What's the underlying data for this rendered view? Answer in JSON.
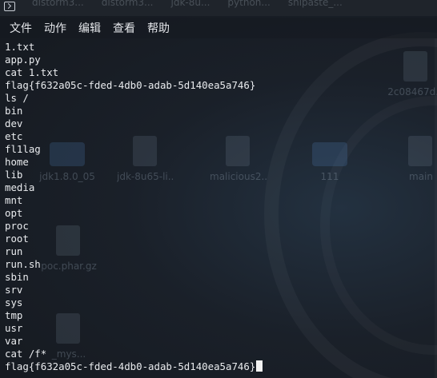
{
  "window": {
    "menu": [
      "文件",
      "动作",
      "编辑",
      "查看",
      "帮助"
    ]
  },
  "background_tabs": [
    "distorm3...",
    "distorm3...",
    "jdk-8u...",
    "python...",
    "shipaste_..."
  ],
  "desktop_icons": [
    {
      "label": "jdk1.8.0_05",
      "icon": "folder-icon"
    },
    {
      "label": "jdk-8u65-li...",
      "icon": "file-icon"
    },
    {
      "label": "malicious2...",
      "icon": "file-icon"
    },
    {
      "label": "111",
      "icon": "folder-icon"
    },
    {
      "label": "main",
      "icon": "gear-icon"
    },
    {
      "label": "poc.phar.gz",
      "icon": "archive-icon"
    },
    {
      "label": "2c08467d...",
      "icon": "file-icon"
    },
    {
      "label": "_mys...",
      "icon": "python-icon"
    }
  ],
  "terminal": {
    "lines": [
      "1.txt",
      "app.py",
      "cat 1.txt",
      "flag{f632a05c-fded-4db0-adab-5d140ea5a746}",
      "ls /",
      "bin",
      "dev",
      "etc",
      "fl1lag",
      "home",
      "lib",
      "media",
      "mnt",
      "opt",
      "proc",
      "root",
      "run",
      "run.sh",
      "sbin",
      "srv",
      "sys",
      "tmp",
      "usr",
      "var",
      "cat /f*",
      "flag{f632a05c-fded-4db0-adab-5d140ea5a746}"
    ]
  },
  "colors": {
    "background": "#1c2127",
    "text": "#e9ebee",
    "menu_text": "#e4e6ea"
  }
}
